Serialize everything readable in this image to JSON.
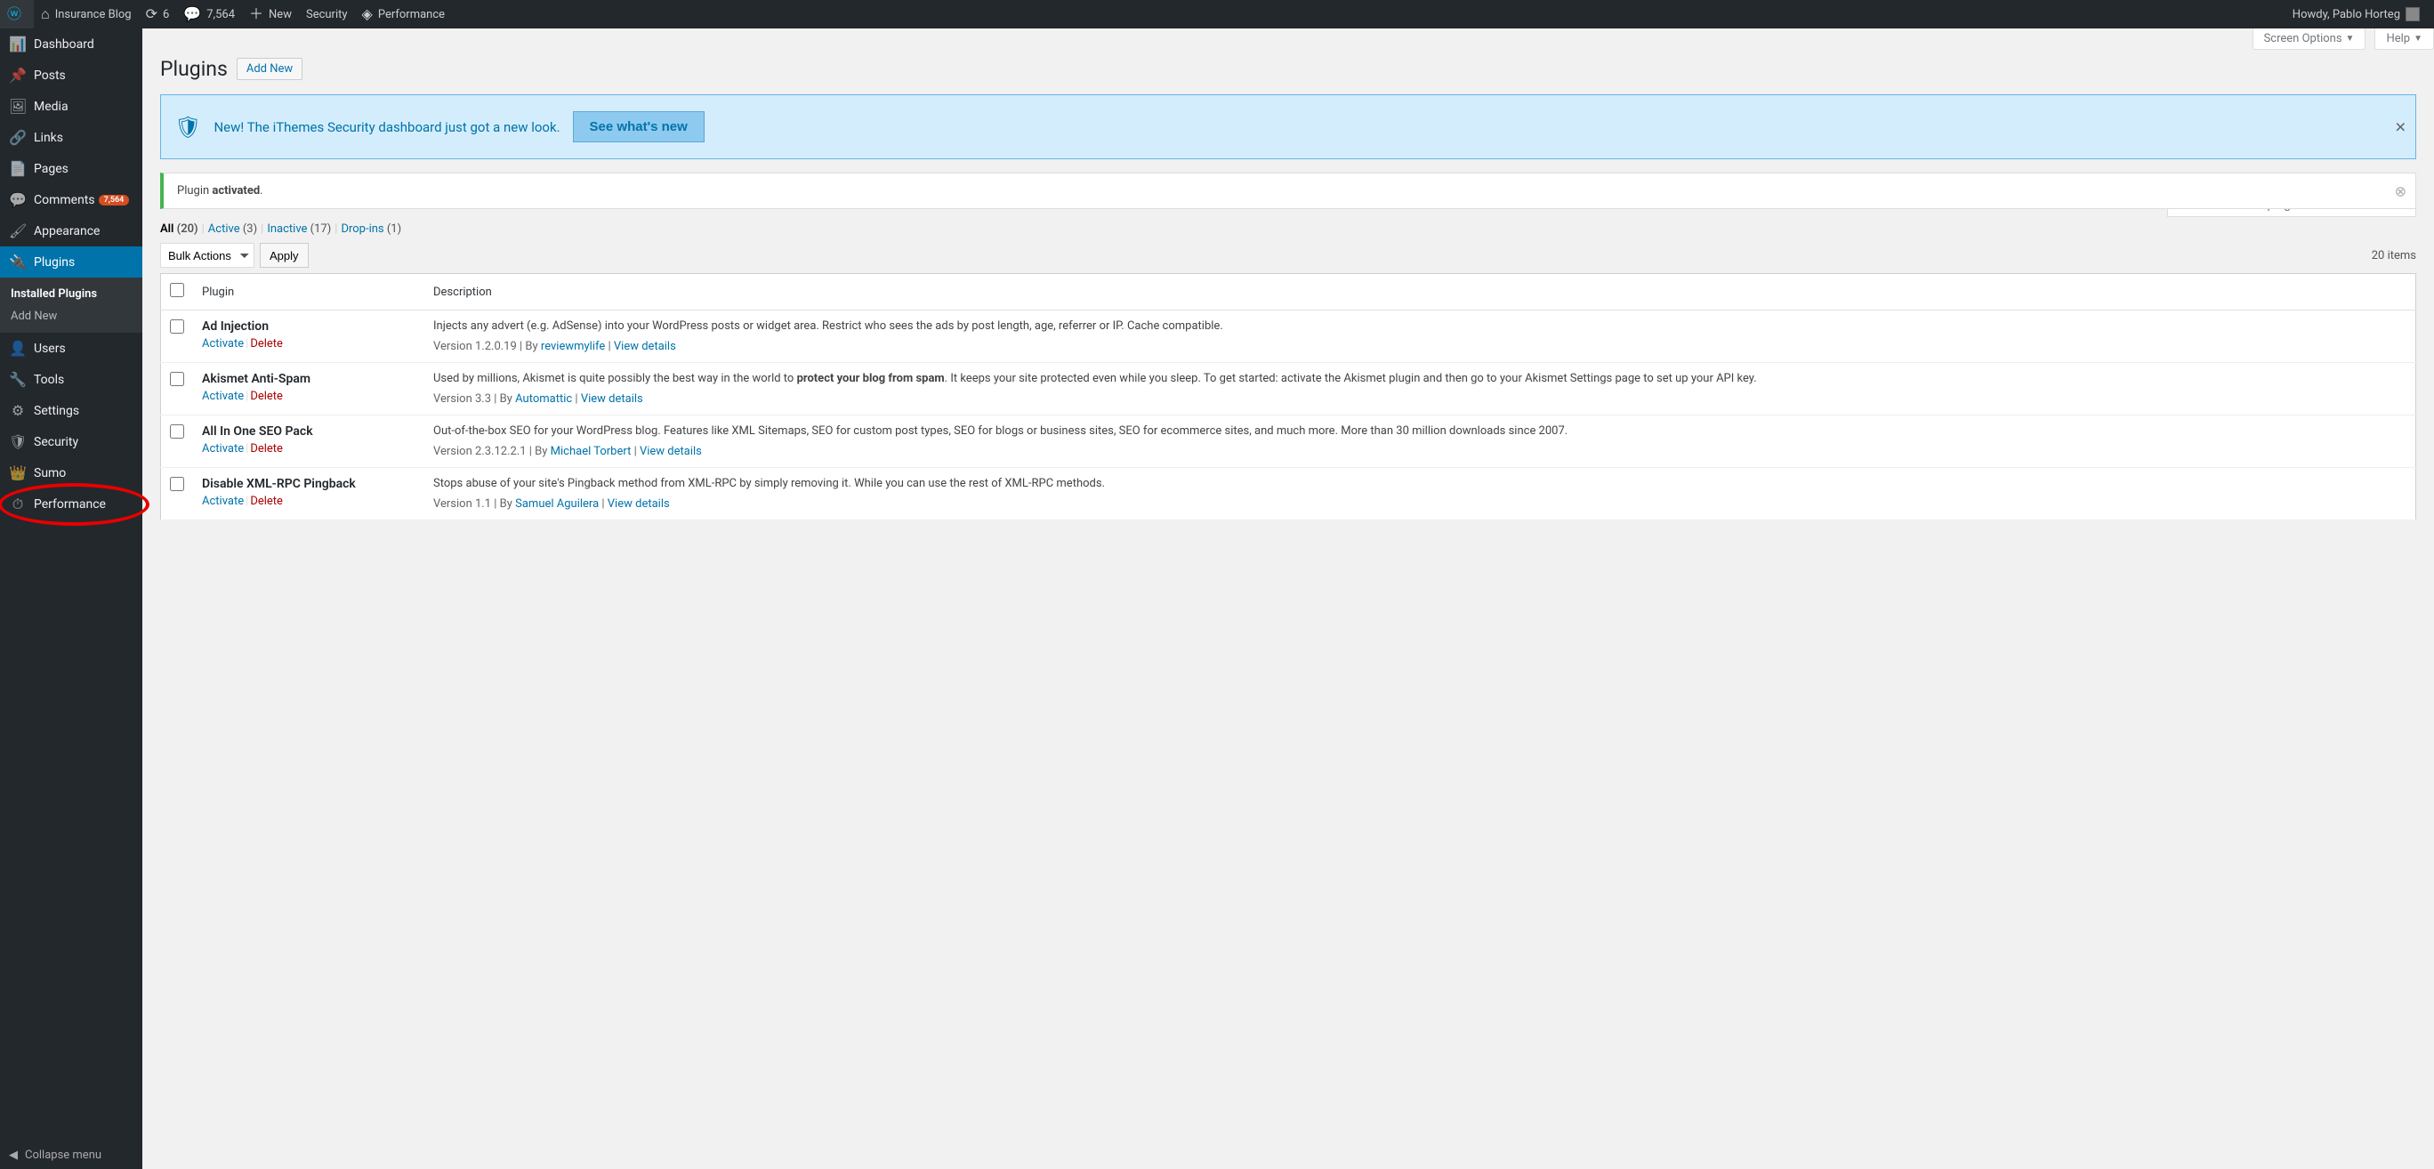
{
  "adminbar": {
    "site_name": "Insurance Blog",
    "updates": "6",
    "comments": "7,564",
    "new_label": "New",
    "security_label": "Security",
    "performance_label": "Performance",
    "howdy": "Howdy, Pablo Horteg"
  },
  "sidebar": [
    {
      "icon": "📊",
      "label": "Dashboard",
      "name": "dashboard"
    },
    {
      "icon": "📌",
      "label": "Posts",
      "name": "posts"
    },
    {
      "icon": "🖼",
      "label": "Media",
      "name": "media"
    },
    {
      "icon": "🔗",
      "label": "Links",
      "name": "links"
    },
    {
      "icon": "📄",
      "label": "Pages",
      "name": "pages"
    },
    {
      "icon": "💬",
      "label": "Comments",
      "name": "comments",
      "badge": "7,564"
    },
    {
      "icon": "🖌",
      "label": "Appearance",
      "name": "appearance"
    },
    {
      "icon": "🔌",
      "label": "Plugins",
      "name": "plugins",
      "current": true,
      "submenu": [
        {
          "label": "Installed Plugins",
          "current": true
        },
        {
          "label": "Add New"
        }
      ]
    },
    {
      "icon": "👤",
      "label": "Users",
      "name": "users"
    },
    {
      "icon": "🔧",
      "label": "Tools",
      "name": "tools"
    },
    {
      "icon": "⚙",
      "label": "Settings",
      "name": "settings"
    },
    {
      "icon": "🛡",
      "label": "Security",
      "name": "security"
    },
    {
      "icon": "👑",
      "label": "Sumo",
      "name": "sumo"
    },
    {
      "icon": "⏱",
      "label": "Performance",
      "name": "performance",
      "highlight": true
    }
  ],
  "collapse_label": "Collapse menu",
  "screen_options": "Screen Options",
  "help": "Help",
  "page_title": "Plugins",
  "add_new": "Add New",
  "ithemes_notice": {
    "text": "New! The iThemes Security dashboard just got a new look.",
    "button": "See what's new"
  },
  "activated_notice_prefix": "Plugin ",
  "activated_notice_strong": "activated",
  "activated_notice_suffix": ".",
  "filters": [
    {
      "label": "All",
      "count": "(20)",
      "current": true
    },
    {
      "label": "Active",
      "count": "(3)"
    },
    {
      "label": "Inactive",
      "count": "(17)"
    },
    {
      "label": "Drop-ins",
      "count": "(1)"
    }
  ],
  "search_placeholder": "Search installed plugins...",
  "bulk_label": "Bulk Actions",
  "apply_label": "Apply",
  "items_count": "20 items",
  "columns": {
    "plugin": "Plugin",
    "description": "Description"
  },
  "actions": {
    "activate": "Activate",
    "delete": "Delete"
  },
  "view_details": "View details",
  "plugins": [
    {
      "name": "Ad Injection",
      "desc": "Injects any advert (e.g. AdSense) into your WordPress posts or widget area. Restrict who sees the ads by post length, age, referrer or IP. Cache compatible.",
      "version": "Version 1.2.0.19",
      "by": "By",
      "author": "reviewmylife"
    },
    {
      "name": "Akismet Anti-Spam",
      "desc_pre": "Used by millions, Akismet is quite possibly the best way in the world to ",
      "desc_strong": "protect your blog from spam",
      "desc_post": ". It keeps your site protected even while you sleep. To get started: activate the Akismet plugin and then go to your Akismet Settings page to set up your API key.",
      "version": "Version 3.3",
      "by": "By",
      "author": "Automattic"
    },
    {
      "name": "All In One SEO Pack",
      "desc": "Out-of-the-box SEO for your WordPress blog. Features like XML Sitemaps, SEO for custom post types, SEO for blogs or business sites, SEO for ecommerce sites, and much more. More than 30 million downloads since 2007.",
      "version": "Version 2.3.12.2.1",
      "by": "By",
      "author": "Michael Torbert"
    },
    {
      "name": "Disable XML-RPC Pingback",
      "desc": "Stops abuse of your site's Pingback method from XML-RPC by simply removing it. While you can use the rest of XML-RPC methods.",
      "version": "Version 1.1",
      "by": "By",
      "author": "Samuel Aguilera"
    }
  ]
}
